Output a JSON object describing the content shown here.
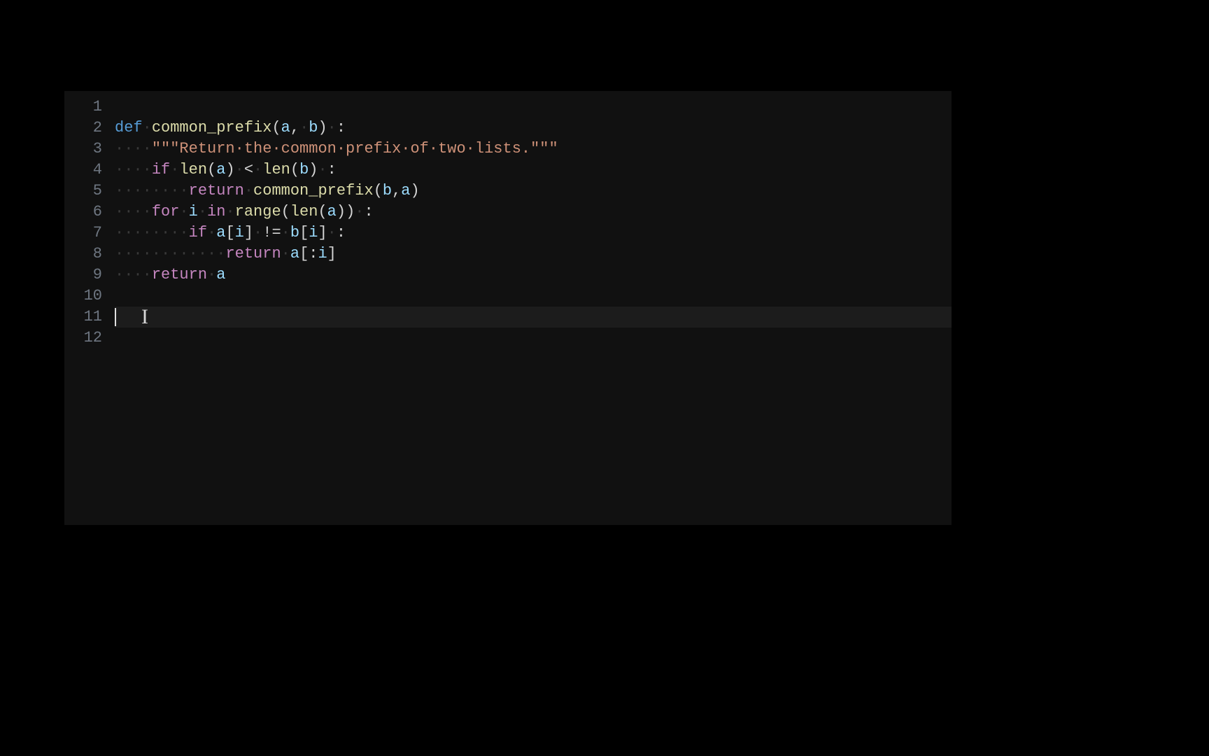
{
  "editor": {
    "language": "python",
    "cursor_line": 11,
    "cursor_column": 0,
    "ibeam_visible": true,
    "line_count": 12,
    "whitespace_rendering": "all",
    "line_numbers": [
      "1",
      "2",
      "3",
      "4",
      "5",
      "6",
      "7",
      "8",
      "9",
      "10",
      "11",
      "12"
    ],
    "lines": [
      {
        "n": 1,
        "indent": 0,
        "tokens": []
      },
      {
        "n": 2,
        "indent": 0,
        "tokens": [
          {
            "t": "def",
            "c": "keyword"
          },
          {
            "t": " ",
            "c": "ws"
          },
          {
            "t": "common_prefix",
            "c": "func"
          },
          {
            "t": "(",
            "c": "punc"
          },
          {
            "t": "a",
            "c": "param"
          },
          {
            "t": ",",
            "c": "punc"
          },
          {
            "t": " ",
            "c": "ws"
          },
          {
            "t": "b",
            "c": "param"
          },
          {
            "t": ")",
            "c": "punc"
          },
          {
            "t": " ",
            "c": "ws"
          },
          {
            "t": ":",
            "c": "punc"
          }
        ]
      },
      {
        "n": 3,
        "indent": 4,
        "tokens": [
          {
            "t": "\"\"\"Return the common prefix of two lists.\"\"\"",
            "c": "string"
          }
        ]
      },
      {
        "n": 4,
        "indent": 4,
        "tokens": [
          {
            "t": "if",
            "c": "ctrl"
          },
          {
            "t": " ",
            "c": "ws"
          },
          {
            "t": "len",
            "c": "func"
          },
          {
            "t": "(",
            "c": "punc"
          },
          {
            "t": "a",
            "c": "param"
          },
          {
            "t": ")",
            "c": "punc"
          },
          {
            "t": " ",
            "c": "ws"
          },
          {
            "t": "<",
            "c": "punc"
          },
          {
            "t": " ",
            "c": "ws"
          },
          {
            "t": "len",
            "c": "func"
          },
          {
            "t": "(",
            "c": "punc"
          },
          {
            "t": "b",
            "c": "param"
          },
          {
            "t": ")",
            "c": "punc"
          },
          {
            "t": " ",
            "c": "ws"
          },
          {
            "t": ":",
            "c": "punc"
          }
        ]
      },
      {
        "n": 5,
        "indent": 8,
        "tokens": [
          {
            "t": "return",
            "c": "ctrl"
          },
          {
            "t": " ",
            "c": "ws"
          },
          {
            "t": "common_prefix",
            "c": "func"
          },
          {
            "t": "(",
            "c": "punc"
          },
          {
            "t": "b",
            "c": "param"
          },
          {
            "t": ",",
            "c": "punc"
          },
          {
            "t": "a",
            "c": "param"
          },
          {
            "t": ")",
            "c": "punc"
          }
        ]
      },
      {
        "n": 6,
        "indent": 4,
        "tokens": [
          {
            "t": "for",
            "c": "ctrl"
          },
          {
            "t": " ",
            "c": "ws"
          },
          {
            "t": "i",
            "c": "param"
          },
          {
            "t": " ",
            "c": "ws"
          },
          {
            "t": "in",
            "c": "ctrl"
          },
          {
            "t": " ",
            "c": "ws"
          },
          {
            "t": "range",
            "c": "func"
          },
          {
            "t": "(",
            "c": "punc"
          },
          {
            "t": "len",
            "c": "func"
          },
          {
            "t": "(",
            "c": "punc"
          },
          {
            "t": "a",
            "c": "param"
          },
          {
            "t": ")",
            "c": "punc"
          },
          {
            "t": ")",
            "c": "punc"
          },
          {
            "t": " ",
            "c": "ws"
          },
          {
            "t": ":",
            "c": "punc"
          }
        ]
      },
      {
        "n": 7,
        "indent": 8,
        "tokens": [
          {
            "t": "if",
            "c": "ctrl"
          },
          {
            "t": " ",
            "c": "ws"
          },
          {
            "t": "a",
            "c": "param"
          },
          {
            "t": "[",
            "c": "punc"
          },
          {
            "t": "i",
            "c": "param"
          },
          {
            "t": "]",
            "c": "punc"
          },
          {
            "t": " ",
            "c": "ws"
          },
          {
            "t": "!=",
            "c": "punc"
          },
          {
            "t": " ",
            "c": "ws"
          },
          {
            "t": "b",
            "c": "param"
          },
          {
            "t": "[",
            "c": "punc"
          },
          {
            "t": "i",
            "c": "param"
          },
          {
            "t": "]",
            "c": "punc"
          },
          {
            "t": " ",
            "c": "ws"
          },
          {
            "t": ":",
            "c": "punc"
          }
        ]
      },
      {
        "n": 8,
        "indent": 12,
        "tokens": [
          {
            "t": "return",
            "c": "ctrl"
          },
          {
            "t": " ",
            "c": "ws"
          },
          {
            "t": "a",
            "c": "param"
          },
          {
            "t": "[",
            "c": "punc"
          },
          {
            "t": ":",
            "c": "punc"
          },
          {
            "t": "i",
            "c": "param"
          },
          {
            "t": "]",
            "c": "punc"
          }
        ]
      },
      {
        "n": 9,
        "indent": 4,
        "tokens": [
          {
            "t": "return",
            "c": "ctrl"
          },
          {
            "t": " ",
            "c": "ws"
          },
          {
            "t": "a",
            "c": "param"
          }
        ]
      },
      {
        "n": 10,
        "indent": 0,
        "tokens": []
      },
      {
        "n": 11,
        "indent": 0,
        "tokens": []
      },
      {
        "n": 12,
        "indent": 0,
        "tokens": []
      }
    ]
  },
  "colors": {
    "background": "#000000",
    "editor_bg": "#111111",
    "line_number": "#6e7681",
    "current_line_bg": "#1c1c1c",
    "whitespace": "#3a3a3a",
    "keyword": "#569cd6",
    "control": "#c586c0",
    "function": "#dcdcaa",
    "param": "#9cdcfe",
    "string": "#ce9178",
    "default": "#d4d4d4"
  }
}
